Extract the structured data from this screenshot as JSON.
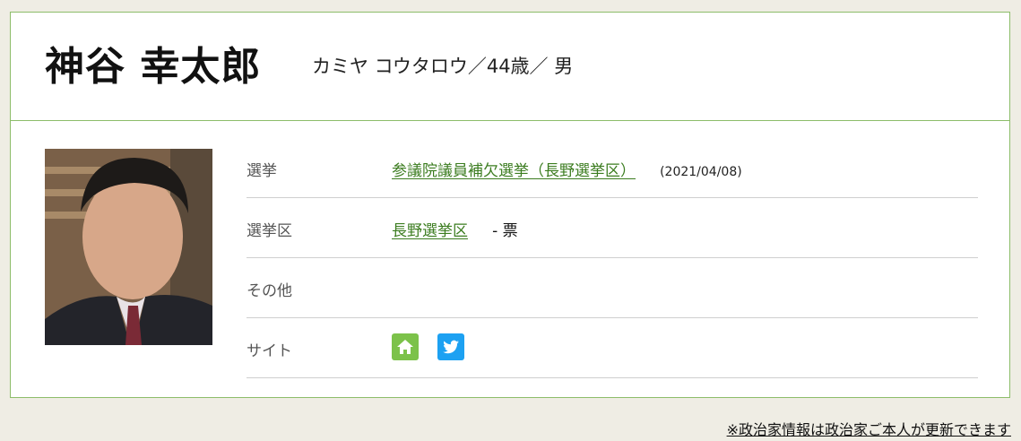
{
  "profile": {
    "name": "神谷 幸太郎",
    "kana_age_gender": "カミヤ コウタロウ／44歳／ 男"
  },
  "details": {
    "election": {
      "label": "選挙",
      "link_text": "参議院議員補欠選挙（長野選挙区）",
      "date": "(2021/04/08)"
    },
    "district": {
      "label": "選挙区",
      "link_text": "長野選挙区",
      "votes": "- 票"
    },
    "other": {
      "label": "その他"
    },
    "site": {
      "label": "サイト",
      "icons": [
        "home-icon",
        "twitter-icon"
      ]
    }
  },
  "footer": {
    "note": "※政治家情報は政治家ご本人が更新できます"
  },
  "colors": {
    "accent_green": "#3b7c1f",
    "border_green": "#8dbd6a",
    "home_button": "#7cc24a",
    "twitter_button": "#1da1f2",
    "background": "#efede4"
  }
}
